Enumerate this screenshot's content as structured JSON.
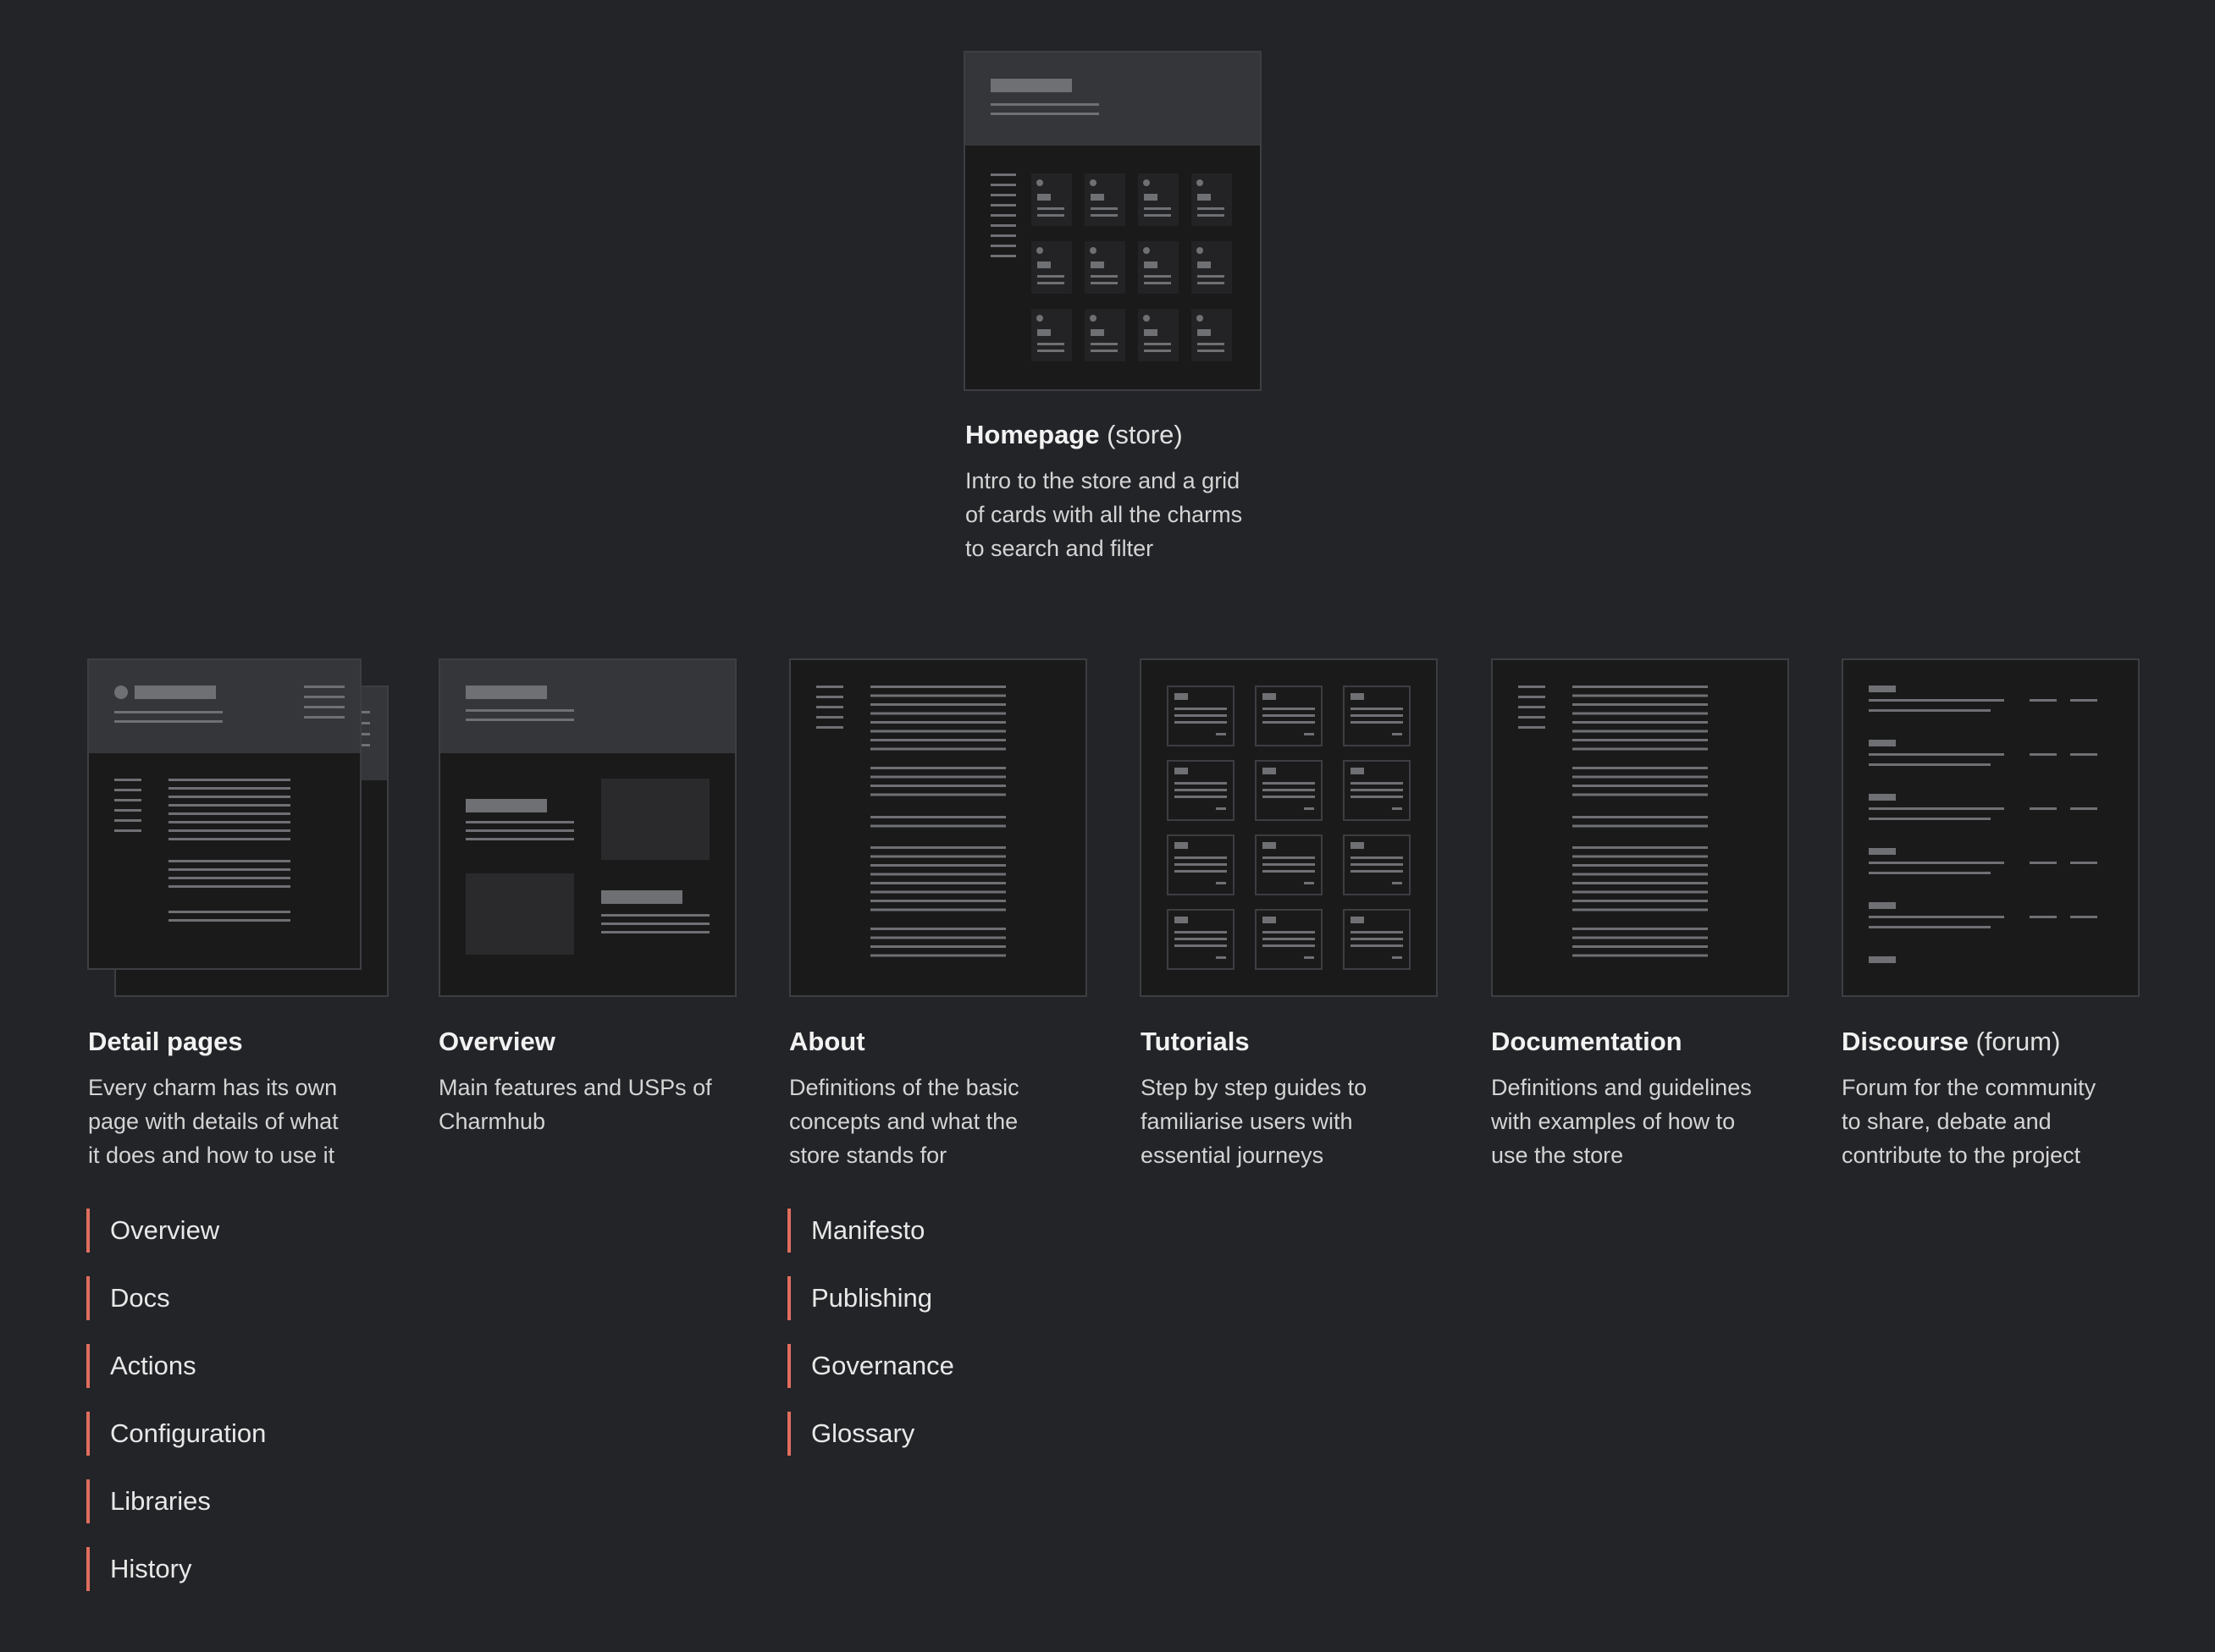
{
  "colors": {
    "background": "#232428",
    "frame": "#1a1a1b",
    "frame_border": "#3d3e42",
    "header_band": "#35363a",
    "placeholder_line": "#6f7073",
    "placeholder_block": "#2a2a2c",
    "link_accent": "#e06e5e"
  },
  "homepage": {
    "title": "Homepage",
    "suffix": "(store)",
    "description": "Intro to the store and a grid\nof cards with all the charms\nto search and filter"
  },
  "sections": [
    {
      "title": "Detail pages",
      "suffix": "",
      "description": "Every charm has its own\npage with details of what\nit does and how to use it",
      "links": [
        "Overview",
        "Docs",
        "Actions",
        "Configuration",
        "Libraries",
        "History"
      ]
    },
    {
      "title": "Overview",
      "suffix": "",
      "description": "Main features and USPs of\nCharmhub",
      "links": []
    },
    {
      "title": "About",
      "suffix": "",
      "description": "Definitions of the basic\nconcepts and what the\nstore stands for",
      "links": [
        "Manifesto",
        "Publishing",
        "Governance",
        "Glossary"
      ]
    },
    {
      "title": "Tutorials",
      "suffix": "",
      "description": "Step by step guides to\nfamiliarise users with\nessential journeys",
      "links": []
    },
    {
      "title": "Documentation",
      "suffix": "",
      "description": "Definitions and guidelines\nwith examples of how to\nuse the store",
      "links": []
    },
    {
      "title": "Discourse",
      "suffix": "(forum)",
      "description": "Forum for the community\nto share, debate and\ncontribute to the project",
      "links": []
    }
  ]
}
